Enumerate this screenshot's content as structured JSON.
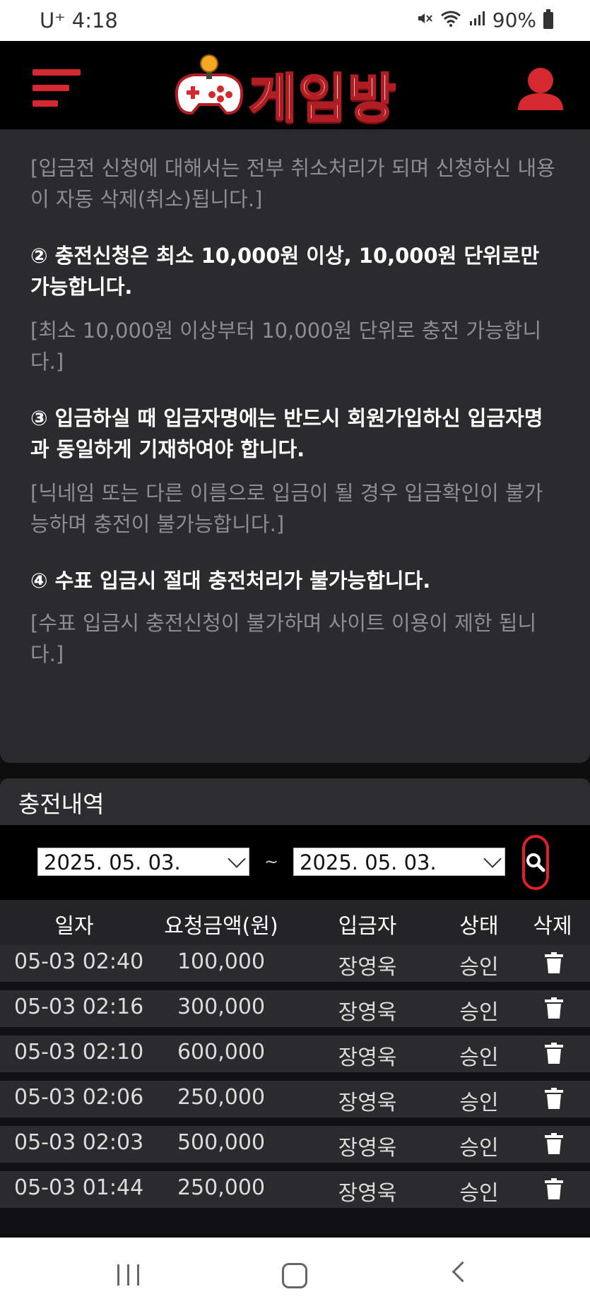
{
  "status_bar": {
    "carrier_time": "U⁺ 4:18",
    "battery": "90%"
  },
  "header": {
    "logo_text": "게임방"
  },
  "notice": {
    "lines": [
      "[입금전 신청에 대해서는 전부 취소처리가 되며 신청하신 내용이 자동 삭제(취소)됩니다.]",
      "② 충전신청은 최소 10,000원 이상, 10,000원 단위로만 가능합니다.",
      "[최소 10,000원 이상부터 10,000원 단위로 충전 가능합니다.]",
      "③ 입금하실 때 입금자명에는 반드시 회원가입하신 입금자명과 동일하게 기재하여야 합니다.",
      "[닉네임 또는 다른 이름으로 입금이 될 경우 입금확인이 불가능하며 충전이 불가능합니다.]",
      "④ 수표 입금시 절대 충전처리가 불가능합니다.",
      "[수표 입금시 충전신청이 불가하며 사이트 이용이 제한 됩니다.]"
    ]
  },
  "history": {
    "title": "충전내역",
    "date_from": "2025. 05. 03.",
    "date_to": "2025. 05. 03.",
    "separator": "~",
    "columns": [
      "일자",
      "요청금액(원)",
      "입금자",
      "상태",
      "삭제"
    ],
    "rows": [
      {
        "date": "05-03 02:40",
        "amount": "100,000",
        "depositor": "장영욱",
        "status": "승인"
      },
      {
        "date": "05-03 02:16",
        "amount": "300,000",
        "depositor": "장영욱",
        "status": "승인"
      },
      {
        "date": "05-03 02:10",
        "amount": "600,000",
        "depositor": "장영욱",
        "status": "승인"
      },
      {
        "date": "05-03 02:06",
        "amount": "250,000",
        "depositor": "장영욱",
        "status": "승인"
      },
      {
        "date": "05-03 02:03",
        "amount": "500,000",
        "depositor": "장영욱",
        "status": "승인"
      },
      {
        "date": "05-03 01:44",
        "amount": "250,000",
        "depositor": "장영욱",
        "status": "승인"
      }
    ]
  },
  "colors": {
    "accent": "#d42a2f",
    "panel": "#2b2b2d",
    "muted_text": "#8e8e92"
  }
}
